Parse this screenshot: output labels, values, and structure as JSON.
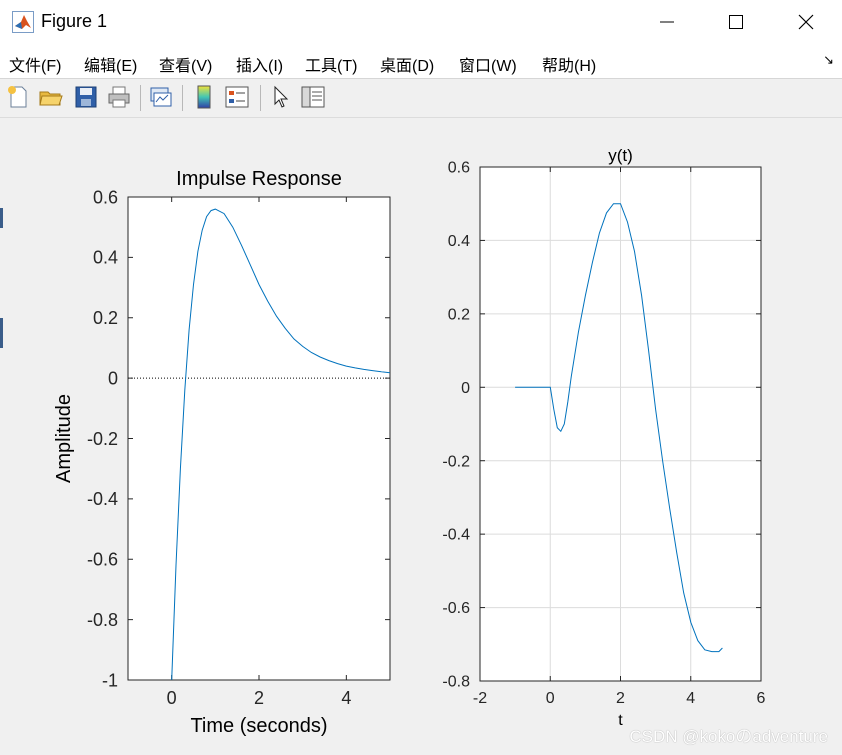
{
  "window": {
    "title": "Figure 1",
    "controls": [
      "minimize",
      "maximize",
      "close"
    ]
  },
  "menubar": {
    "items": [
      "文件(F)",
      "编辑(E)",
      "查看(V)",
      "插入(I)",
      "工具(T)",
      "桌面(D)",
      "窗口(W)",
      "帮助(H)"
    ]
  },
  "toolbar": {
    "icons": [
      "new-figure-icon",
      "open-icon",
      "save-icon",
      "print-icon",
      "link-plot-icon",
      "colorbar-icon",
      "legend-icon",
      "pointer-icon",
      "property-inspector-icon"
    ]
  },
  "watermark": "CSDN @kokoのadventure",
  "colors": {
    "line": "#0072bd",
    "grid": "#dcdcdc",
    "axes": "#262626"
  },
  "chart_data": [
    {
      "type": "line",
      "title": "Impulse Response",
      "xlabel": "Time (seconds)",
      "ylabel": "Amplitude",
      "xlim": [
        -1,
        5
      ],
      "ylim": [
        -1,
        0.6
      ],
      "xticks": [
        0,
        2,
        4
      ],
      "xtick_labels": [
        "0",
        "2",
        "4"
      ],
      "yticks": [
        -1,
        -0.8,
        -0.6,
        -0.4,
        -0.2,
        0,
        0.2,
        0.4,
        0.6
      ],
      "ytick_labels": [
        "-1",
        "-0.8",
        "-0.6",
        "-0.4",
        "-0.2",
        "0",
        "0.2",
        "0.4",
        "0.6"
      ],
      "grid": false,
      "reference_line": {
        "y": 0,
        "style": "dotted"
      },
      "series": [
        {
          "x": [
            0.0,
            0.1,
            0.2,
            0.3,
            0.4,
            0.5,
            0.6,
            0.7,
            0.8,
            0.9,
            1.0,
            1.2,
            1.4,
            1.6,
            1.8,
            2.0,
            2.2,
            2.4,
            2.6,
            2.8,
            3.0,
            3.2,
            3.4,
            3.6,
            3.8,
            4.0,
            4.2,
            4.4,
            4.6,
            4.8,
            5.0
          ],
          "y": [
            -1.0,
            -0.62,
            -0.3,
            -0.04,
            0.16,
            0.31,
            0.42,
            0.49,
            0.535,
            0.555,
            0.56,
            0.545,
            0.5,
            0.44,
            0.375,
            0.31,
            0.255,
            0.205,
            0.165,
            0.13,
            0.105,
            0.085,
            0.07,
            0.058,
            0.048,
            0.04,
            0.034,
            0.029,
            0.025,
            0.021,
            0.018
          ]
        }
      ]
    },
    {
      "type": "line",
      "title": "y(t)",
      "xlabel": "t",
      "ylabel": "",
      "xlim": [
        -2,
        6
      ],
      "ylim": [
        -0.8,
        0.6
      ],
      "xticks": [
        -2,
        0,
        2,
        4,
        6
      ],
      "xtick_labels": [
        "-2",
        "0",
        "2",
        "4",
        "6"
      ],
      "yticks": [
        -0.8,
        -0.6,
        -0.4,
        -0.2,
        0,
        0.2,
        0.4,
        0.6
      ],
      "ytick_labels": [
        "-0.8",
        "-0.6",
        "-0.4",
        "-0.2",
        "0",
        "0.2",
        "0.4",
        "0.6"
      ],
      "grid": true,
      "series": [
        {
          "x": [
            -1.0,
            -0.5,
            0.0,
            0.1,
            0.2,
            0.3,
            0.4,
            0.5,
            0.6,
            0.8,
            1.0,
            1.2,
            1.4,
            1.6,
            1.8,
            2.0,
            2.2,
            2.4,
            2.6,
            2.8,
            3.0,
            3.2,
            3.4,
            3.6,
            3.8,
            4.0,
            4.2,
            4.4,
            4.6,
            4.8,
            4.9
          ],
          "y": [
            0.0,
            0.0,
            0.0,
            -0.06,
            -0.11,
            -0.12,
            -0.1,
            -0.04,
            0.03,
            0.15,
            0.25,
            0.34,
            0.42,
            0.475,
            0.5,
            0.5,
            0.45,
            0.37,
            0.25,
            0.1,
            -0.06,
            -0.2,
            -0.33,
            -0.45,
            -0.56,
            -0.64,
            -0.69,
            -0.715,
            -0.72,
            -0.72,
            -0.71
          ]
        }
      ]
    }
  ]
}
